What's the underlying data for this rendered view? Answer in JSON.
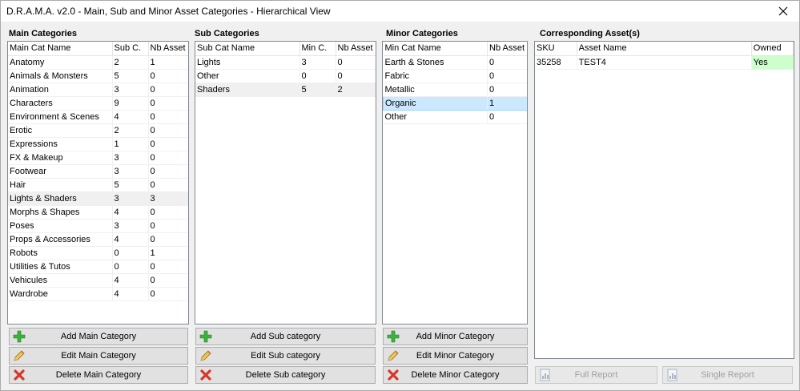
{
  "window": {
    "title": "D.R.A.M.A. v2.0 - Main, Sub and Minor Asset Categories - Hierarchical View"
  },
  "colors": {
    "selection": "#cce8ff",
    "owned_yes": "#ccffcc",
    "add_icon": "#3cb33c",
    "delete_icon": "#d9352b"
  },
  "main": {
    "label": "Main Categories",
    "headers": [
      "Main Cat Name",
      "Sub C.",
      "Nb Asset"
    ],
    "rows": [
      [
        "Anatomy",
        "2",
        "1"
      ],
      [
        "Animals & Monsters",
        "5",
        "0"
      ],
      [
        "Animation",
        "3",
        "0"
      ],
      [
        "Characters",
        "9",
        "0"
      ],
      [
        "Environment & Scenes",
        "4",
        "0"
      ],
      [
        "Erotic",
        "2",
        "0"
      ],
      [
        "Expressions",
        "1",
        "0"
      ],
      [
        "FX & Makeup",
        "3",
        "0"
      ],
      [
        "Footwear",
        "3",
        "0"
      ],
      [
        "Hair",
        "5",
        "0"
      ],
      [
        "Lights & Shaders",
        "3",
        "3"
      ],
      [
        "Morphs & Shapes",
        "4",
        "0"
      ],
      [
        "Poses",
        "3",
        "0"
      ],
      [
        "Props & Accessories",
        "4",
        "0"
      ],
      [
        "Robots",
        "0",
        "1"
      ],
      [
        "Utilities & Tutos",
        "0",
        "0"
      ],
      [
        "Vehicules",
        "4",
        "0"
      ],
      [
        "Wardrobe",
        "4",
        "0"
      ]
    ],
    "add_label": "Add Main Category",
    "edit_label": "Edit Main Category",
    "delete_label": "Delete Main Category"
  },
  "sub": {
    "label": "Sub Categories",
    "headers": [
      "Sub Cat Name",
      "Min C.",
      "Nb Asset"
    ],
    "rows": [
      [
        "Lights",
        "3",
        "0"
      ],
      [
        "Other",
        "0",
        "0"
      ],
      [
        "Shaders",
        "5",
        "2"
      ]
    ],
    "add_label": "Add Sub category",
    "edit_label": "Edit Sub category",
    "delete_label": "Delete Sub category"
  },
  "minor": {
    "label": "Minor Categories",
    "headers": [
      "Min Cat Name",
      "Nb Asset"
    ],
    "rows": [
      [
        "Earth & Stones",
        "0"
      ],
      [
        "Fabric",
        "0"
      ],
      [
        "Metallic",
        "0"
      ],
      [
        "Organic",
        "1"
      ],
      [
        "Other",
        "0"
      ]
    ],
    "add_label": "Add Minor Category",
    "edit_label": "Edit Minor Category",
    "delete_label": "Delete Minor Category"
  },
  "assets": {
    "label": "Corresponding Asset(s)",
    "headers": [
      "SKU",
      "Asset Name",
      "Owned"
    ],
    "rows": [
      [
        "35258",
        "TEST4",
        "Yes"
      ]
    ],
    "full_report_label": "Full Report",
    "single_report_label": "Single Report"
  }
}
